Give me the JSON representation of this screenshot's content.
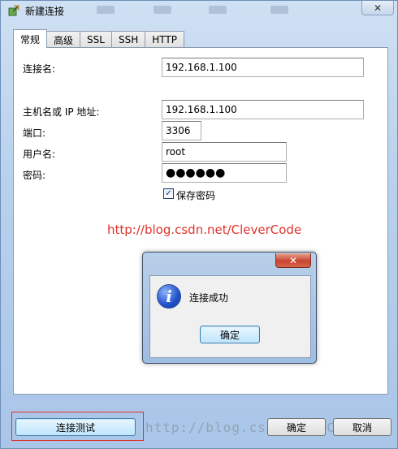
{
  "window": {
    "title": "新建连接",
    "close_glyph": "✕"
  },
  "tabs": [
    {
      "label": "常规",
      "active": true
    },
    {
      "label": "高级",
      "active": false
    },
    {
      "label": "SSL",
      "active": false
    },
    {
      "label": "SSH",
      "active": false
    },
    {
      "label": "HTTP",
      "active": false
    }
  ],
  "form": {
    "connection_name_label": "连接名:",
    "connection_name_value": "192.168.1.100",
    "host_label": "主机名或 IP 地址:",
    "host_value": "192.168.1.100",
    "port_label": "端口:",
    "port_value": "3306",
    "user_label": "用户名:",
    "user_value": "root",
    "password_label": "密码:",
    "password_value": "●●●●●●",
    "save_password_label": "保存密码",
    "save_password_checked": true
  },
  "watermark": {
    "url": "http://blog.csdn.net/CleverCode",
    "bottom_text": "http://blog.csdn.net/CleverCode"
  },
  "dialog": {
    "message": "连接成功",
    "ok_label": "确定",
    "close_glyph": "✕",
    "icon": "info-icon"
  },
  "buttons": {
    "test_label": "连接测试",
    "ok_label": "确定",
    "cancel_label": "取消"
  },
  "colors": {
    "accent_red": "#e0322b",
    "window_frame": "#b9d1ec"
  }
}
